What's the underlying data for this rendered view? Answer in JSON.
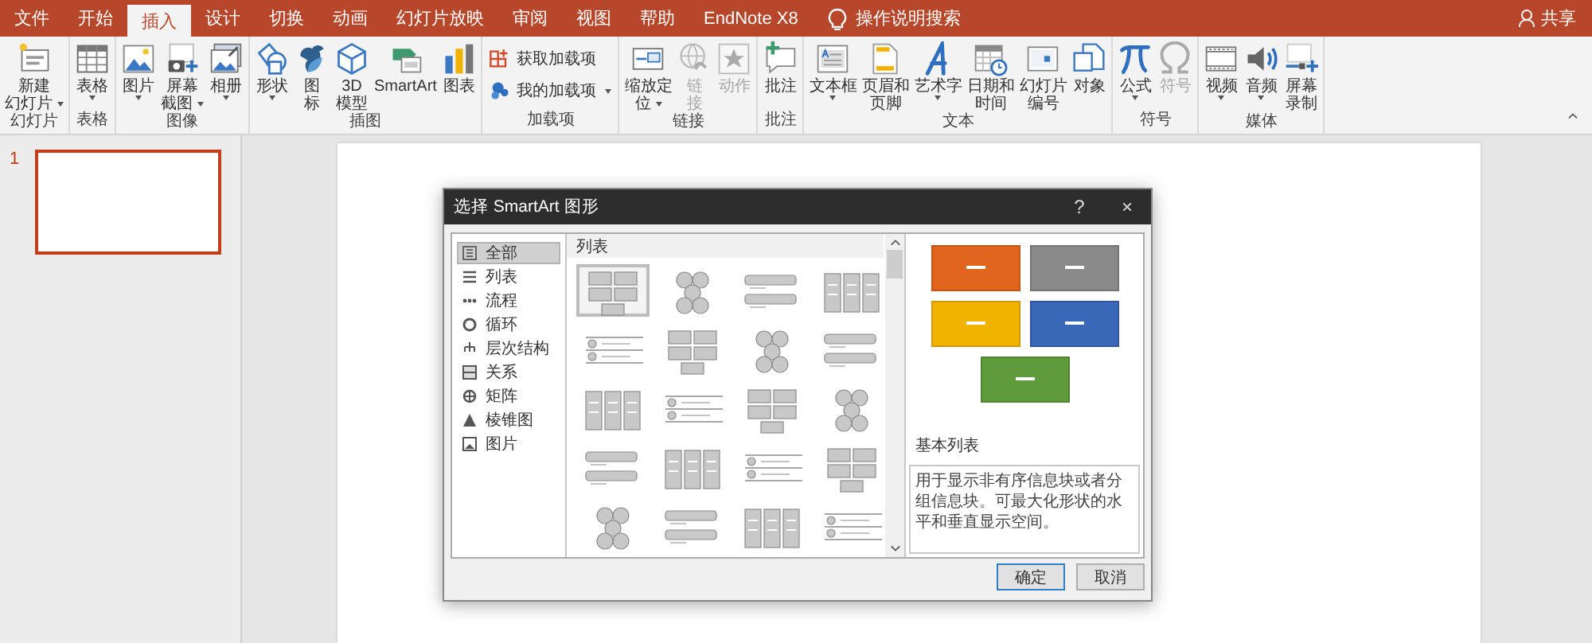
{
  "tabs": [
    {
      "label": "文件",
      "selected": false
    },
    {
      "label": "开始",
      "selected": false
    },
    {
      "label": "插入",
      "selected": true
    },
    {
      "label": "设计",
      "selected": false
    },
    {
      "label": "切换",
      "selected": false
    },
    {
      "label": "动画",
      "selected": false
    },
    {
      "label": "幻灯片放映",
      "selected": false
    },
    {
      "label": "审阅",
      "selected": false
    },
    {
      "label": "视图",
      "selected": false
    },
    {
      "label": "帮助",
      "selected": false
    },
    {
      "label": "EndNote X8",
      "selected": false
    }
  ],
  "tell_me": "操作说明搜索",
  "share": "共享",
  "ribbon": {
    "groups": [
      {
        "label": "幻灯片",
        "items": [
          {
            "kind": "large",
            "label": "新建幻灯片",
            "dropdown": true,
            "disabled": false
          }
        ]
      },
      {
        "label": "表格",
        "items": [
          {
            "kind": "large",
            "label": "表格",
            "dropdown": true,
            "disabled": false
          }
        ]
      },
      {
        "label": "图像",
        "items": [
          {
            "kind": "large",
            "label": "图片",
            "dropdown": true,
            "disabled": false
          },
          {
            "kind": "large",
            "label": "屏幕截图",
            "dropdown": true,
            "disabled": false
          },
          {
            "kind": "large",
            "label": "相册",
            "dropdown": true,
            "disabled": false
          }
        ]
      },
      {
        "label": "插图",
        "items": [
          {
            "kind": "large",
            "label": "形状",
            "dropdown": true,
            "disabled": false
          },
          {
            "kind": "large",
            "label": "图标",
            "dropdown": false,
            "disabled": false
          },
          {
            "kind": "large",
            "label": "3D模型",
            "dropdown": false,
            "disabled": false
          },
          {
            "kind": "large",
            "label": "SmartArt",
            "dropdown": false,
            "disabled": false
          },
          {
            "kind": "large",
            "label": "图表",
            "dropdown": false,
            "disabled": false
          }
        ]
      },
      {
        "label": "加载项",
        "items": [
          {
            "kind": "small",
            "label": "获取加载项",
            "dropdown": false,
            "disabled": false
          },
          {
            "kind": "small",
            "label": "我的加载项",
            "dropdown": true,
            "disabled": false
          }
        ]
      },
      {
        "label": "链接",
        "items": [
          {
            "kind": "large",
            "label": "缩放定位",
            "dropdown": true,
            "disabled": false
          },
          {
            "kind": "large",
            "label": "链接",
            "dropdown": false,
            "disabled": true
          },
          {
            "kind": "large",
            "label": "动作",
            "dropdown": false,
            "disabled": true
          }
        ]
      },
      {
        "label": "批注",
        "items": [
          {
            "kind": "large",
            "label": "批注",
            "dropdown": false,
            "disabled": false
          }
        ]
      },
      {
        "label": "文本",
        "items": [
          {
            "kind": "large",
            "label": "文本框",
            "dropdown": true,
            "disabled": false
          },
          {
            "kind": "large",
            "label": "页眉和页脚",
            "dropdown": false,
            "disabled": false
          },
          {
            "kind": "large",
            "label": "艺术字",
            "dropdown": true,
            "disabled": false
          },
          {
            "kind": "large",
            "label": "日期和时间",
            "dropdown": false,
            "disabled": false
          },
          {
            "kind": "large",
            "label": "幻灯片编号",
            "dropdown": false,
            "disabled": false
          },
          {
            "kind": "large",
            "label": "对象",
            "dropdown": false,
            "disabled": false
          }
        ]
      },
      {
        "label": "符号",
        "items": [
          {
            "kind": "large",
            "label": "公式",
            "dropdown": true,
            "disabled": false
          },
          {
            "kind": "large",
            "label": "符号",
            "dropdown": false,
            "disabled": true
          }
        ]
      },
      {
        "label": "媒体",
        "items": [
          {
            "kind": "large",
            "label": "视频",
            "dropdown": true,
            "disabled": false
          },
          {
            "kind": "large",
            "label": "音频",
            "dropdown": true,
            "disabled": false
          },
          {
            "kind": "large",
            "label": "屏幕录制",
            "dropdown": false,
            "disabled": false
          }
        ]
      }
    ]
  },
  "slides": [
    {
      "number": "1",
      "selected": true
    }
  ],
  "dialog": {
    "title": "选择 SmartArt 图形",
    "help": "?",
    "close": "×",
    "categories": [
      {
        "label": "全部",
        "selected": true
      },
      {
        "label": "列表",
        "selected": false
      },
      {
        "label": "流程",
        "selected": false
      },
      {
        "label": "循环",
        "selected": false
      },
      {
        "label": "层次结构",
        "selected": false
      },
      {
        "label": "关系",
        "selected": false
      },
      {
        "label": "矩阵",
        "selected": false
      },
      {
        "label": "棱锥图",
        "selected": false
      },
      {
        "label": "图片",
        "selected": false
      }
    ],
    "list_heading": "列表",
    "layouts": [
      {
        "selected": true
      },
      {
        "selected": false
      },
      {
        "selected": false
      },
      {
        "selected": false
      },
      {
        "selected": false
      },
      {
        "selected": false
      },
      {
        "selected": false
      },
      {
        "selected": false
      },
      {
        "selected": false
      },
      {
        "selected": false
      },
      {
        "selected": false
      },
      {
        "selected": false
      },
      {
        "selected": false
      },
      {
        "selected": false
      },
      {
        "selected": false
      },
      {
        "selected": false
      },
      {
        "selected": false
      },
      {
        "selected": false
      },
      {
        "selected": false
      },
      {
        "selected": false
      }
    ],
    "preview": {
      "shapes": [
        {
          "color": "#e0651f"
        },
        {
          "color": "#8a8a8a"
        },
        {
          "color": "#f0b400"
        },
        {
          "color": "#3a68b8"
        },
        {
          "color": "#5f9a3c"
        }
      ],
      "title": "基本列表",
      "description": "用于显示非有序信息块或者分组信息块。可最大化形状的水平和垂直显示空间。"
    },
    "buttons": [
      {
        "label": "确定",
        "default": true
      },
      {
        "label": "取消",
        "default": false
      }
    ]
  }
}
